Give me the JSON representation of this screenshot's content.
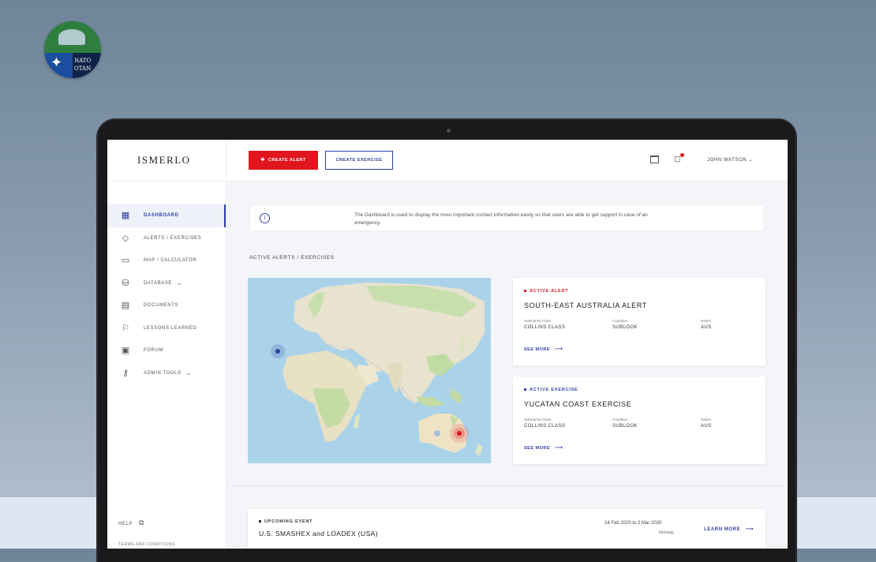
{
  "brand": {
    "name": "ISMERLO",
    "badge_text_1": "NATO",
    "badge_text_2": "OTAN"
  },
  "colors": {
    "accent": "#2e3fa3",
    "alert": "#e0161f",
    "background": "#f4f5f8"
  },
  "topbar": {
    "create_alert": "CREATE ALERT",
    "create_exercise": "CREATE EXERCISE",
    "user_name": "JOHN WATSON",
    "icons": [
      "calendar-icon",
      "bell-icon",
      "chevron-down-icon"
    ]
  },
  "sidebar": {
    "items": [
      {
        "label": "DASHBOARD",
        "icon": "▦",
        "active": true
      },
      {
        "label": "ALERTS / EXERCISES",
        "icon": "◇"
      },
      {
        "label": "MAP / CALCULATOR",
        "icon": "▭"
      },
      {
        "label": "DATABASE",
        "icon": "⛁",
        "has_submenu": true
      },
      {
        "label": "DOCUMENTS",
        "icon": "▤"
      },
      {
        "label": "LESSONS LEARNED",
        "icon": "⚐"
      },
      {
        "label": "FORUM",
        "icon": "▣"
      },
      {
        "label": "ADMIN TOOLS",
        "icon": "⚷",
        "has_submenu": true
      }
    ],
    "help": "HELP",
    "terms": "TERMS AND CONDITIONS"
  },
  "info": {
    "text": "The Dashboard is used to display the most important contact information easily so that users are able to get support in case of an emergency."
  },
  "section_title": "ACTIVE ALERTS / EXERCISES",
  "cards": [
    {
      "tag": "ACTIVE ALERT",
      "title": "SOUTH-EAST AUSTRALIA ALERT",
      "fields": [
        {
          "key": "Submarine Class",
          "value": "COLLINS CLASS"
        },
        {
          "key": "Condition",
          "value": "SUBLOOK"
        },
        {
          "key": "Nation",
          "value": "AUS"
        }
      ],
      "link": "SEE MORE"
    },
    {
      "tag": "ACTIVE EXERCISE",
      "title": "YUCATAN COAST EXERCISE",
      "fields": [
        {
          "key": "Submarine Class",
          "value": "COLLINS CLASS"
        },
        {
          "key": "Condition",
          "value": "SUBLOOK"
        },
        {
          "key": "Nation",
          "value": "AUS"
        }
      ],
      "link": "SEE MORE"
    }
  ],
  "event": {
    "tag": "UPCOMING EVENT",
    "title": "U.S. SMASHEX and LOADEX (USA)",
    "date": "24 Feb 2020 to 2 Mar 2020",
    "location": "Norway",
    "link": "LEARN MORE"
  }
}
